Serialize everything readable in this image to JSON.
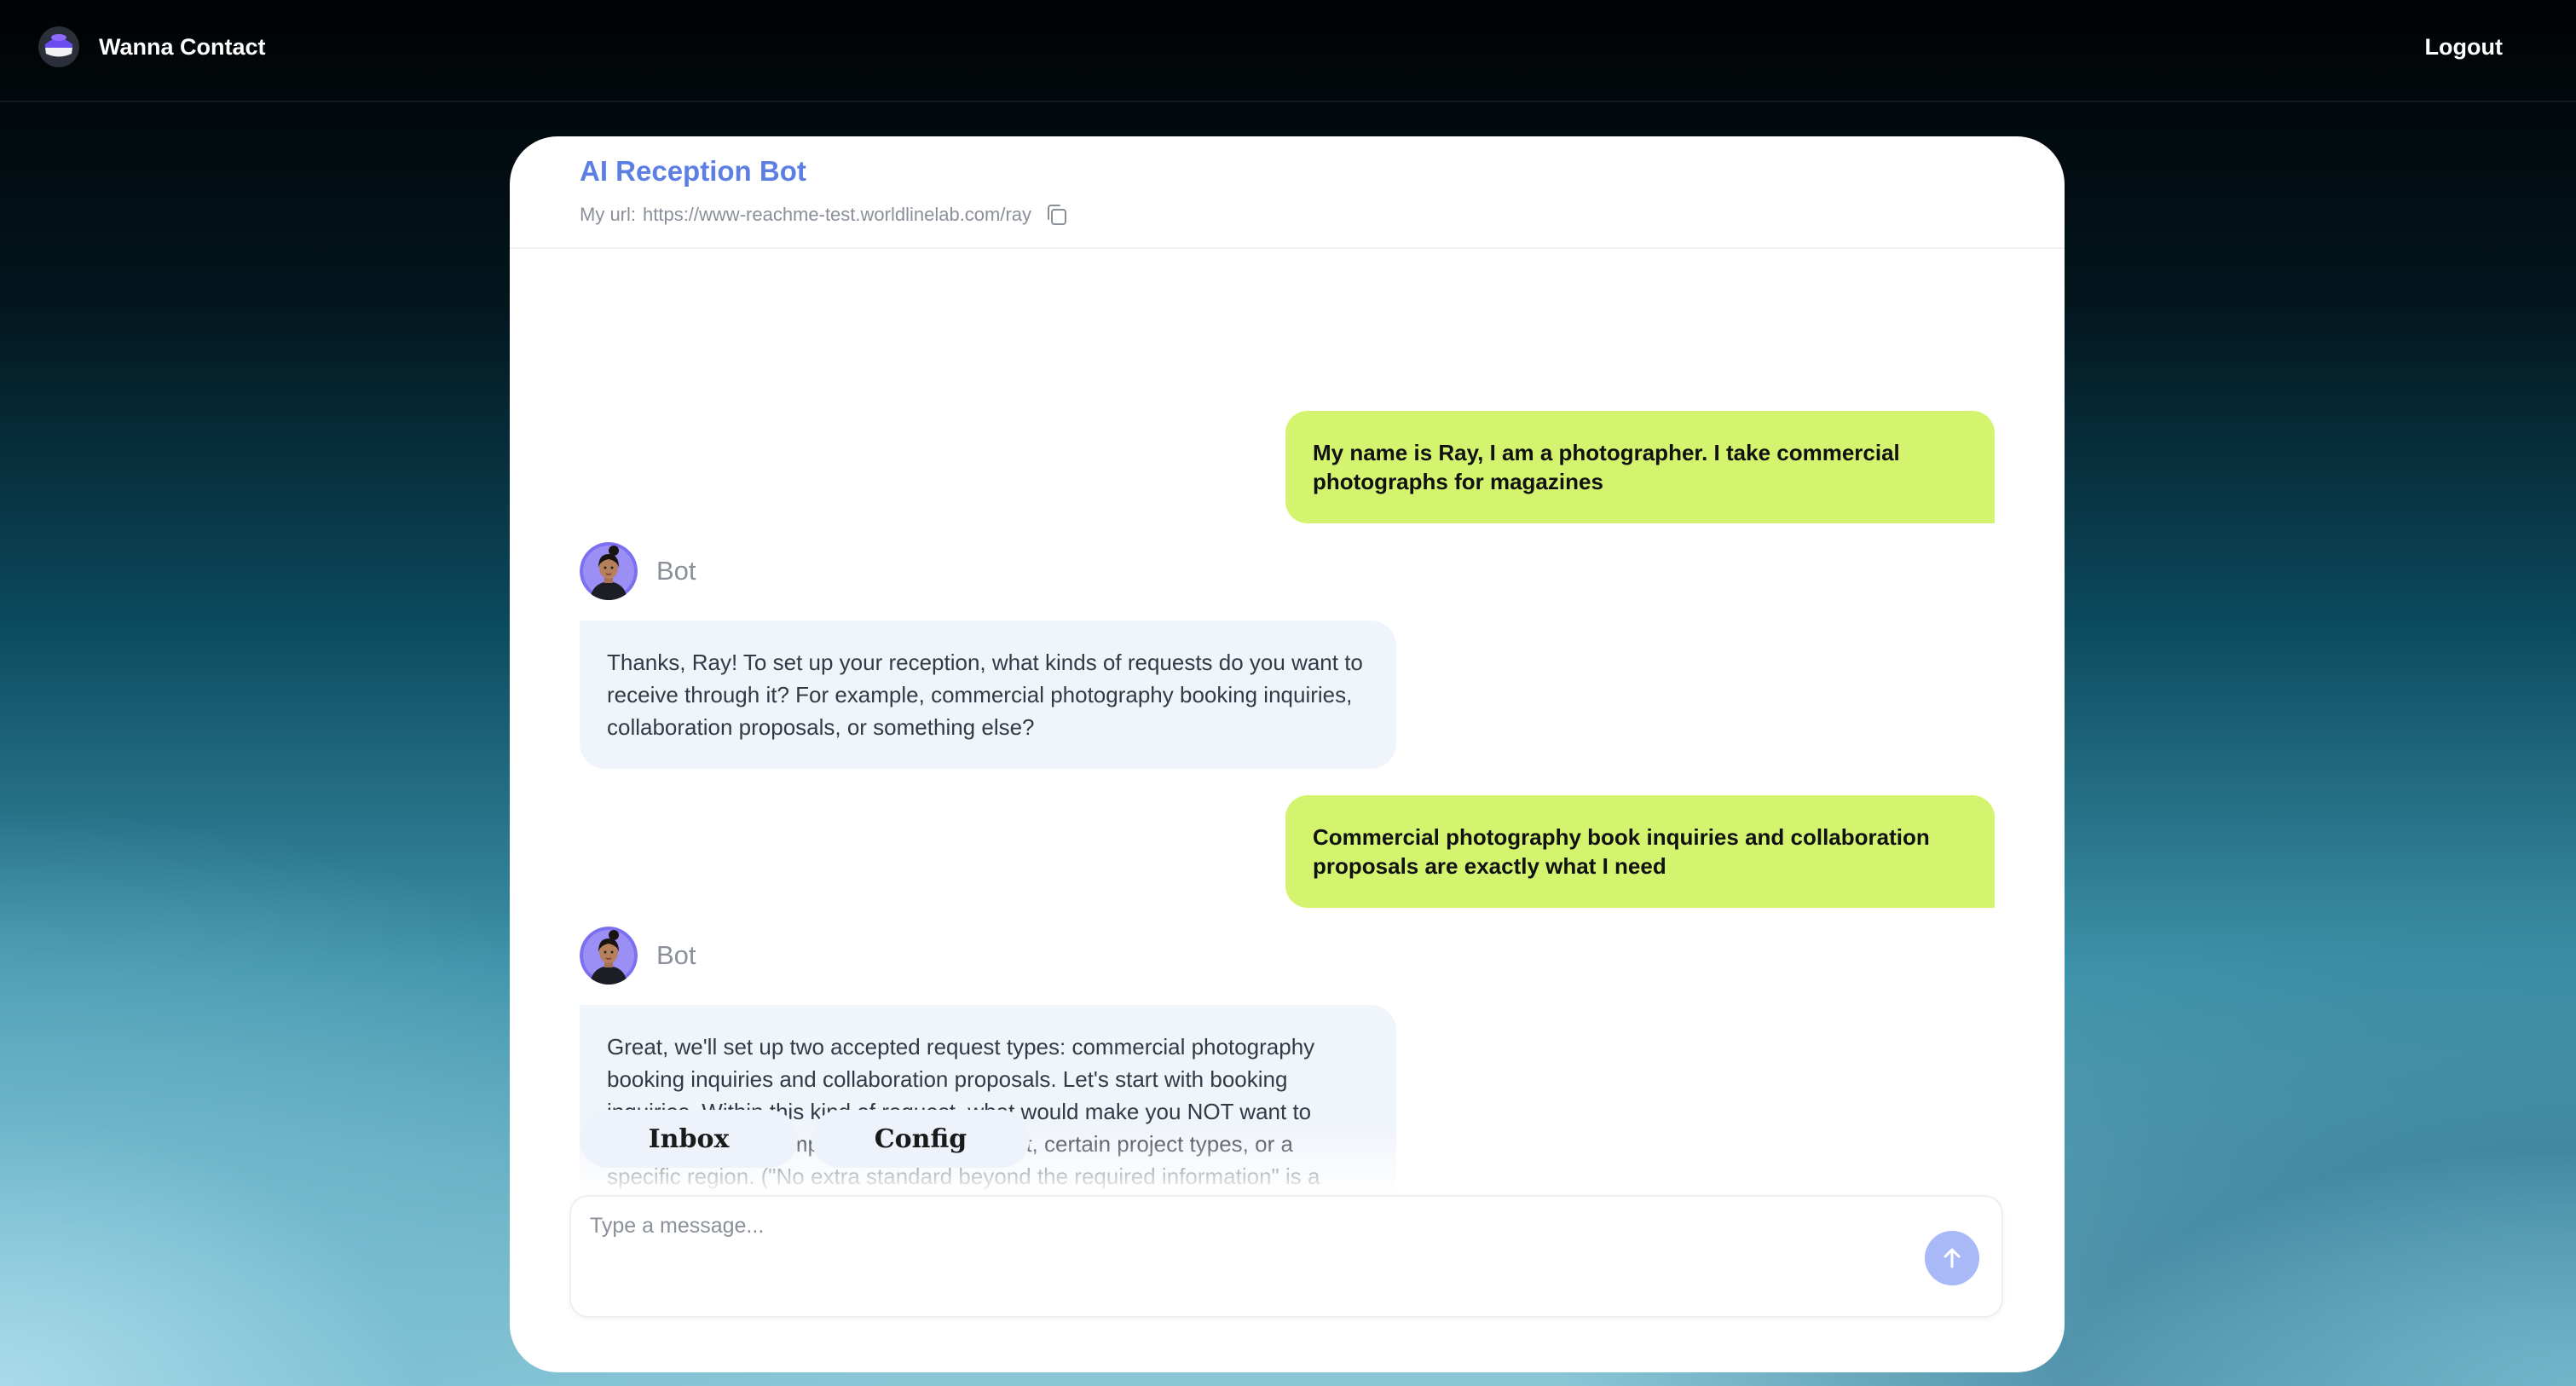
{
  "app": {
    "name": "Wanna Contact",
    "logo_icon": "brand-logo-icon",
    "logout_label": "Logout"
  },
  "header": {
    "title": "AI Reception Bot",
    "url_label": "My url:",
    "url_value": "https://www-reachme-test.worldlinelab.com/ray",
    "copy_icon": "copy-icon"
  },
  "messages": [
    {
      "role": "user",
      "text": "My name is Ray, I am a photographer. I take commercial photographs for magazines"
    },
    {
      "role": "bot",
      "sender": "Bot",
      "text": "Thanks, Ray! To set up your reception, what kinds of requests do you want to receive through it? For example, commercial photography booking inquiries, collaboration proposals, or something else?"
    },
    {
      "role": "user",
      "text": "Commercial photography book inquiries and collaboration proposals are exactly what I need"
    },
    {
      "role": "bot",
      "sender": "Bot",
      "text": "Great, we'll set up two accepted request types: commercial photography booking inquiries and collaboration proposals. Let's start with booking inquiries. Within this kind of request, what would make you NOT want to receive it? For example, a minimum budget, certain project types, or a specific region. (\"No extra standard beyond the required information\" is a perfectly"
    }
  ],
  "quick_actions": [
    "Inbox",
    "Config"
  ],
  "composer": {
    "placeholder": "Type a message...",
    "value": "",
    "send_icon": "arrow-up-icon"
  },
  "colors": {
    "accent": "#5d7fe4",
    "user_bubble": "#d4f46f",
    "bot_bubble": "#f0f4fb",
    "send_button": "#a9b8f7"
  }
}
